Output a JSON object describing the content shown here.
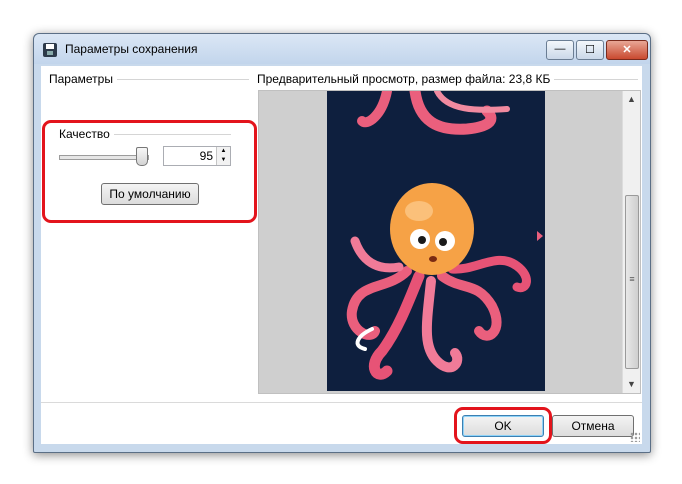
{
  "window": {
    "title": "Параметры сохранения",
    "minimize_glyph": "—",
    "maximize_glyph": "☐",
    "close_glyph": "✕"
  },
  "left_panel": {
    "group_label": "Параметры",
    "quality": {
      "label": "Качество",
      "value": "95",
      "slider_fraction": 0.95
    },
    "default_button_label": "По умолчанию"
  },
  "preview": {
    "header_label": "Предварительный просмотр, размер файла: 23,8 КБ",
    "scroll_up_glyph": "▲",
    "scroll_down_glyph": "▼",
    "scroll_grip_glyph": "≡"
  },
  "footer": {
    "ok_label": "OK",
    "cancel_label": "Отмена"
  },
  "colors": {
    "highlight_red": "#e3141c",
    "preview_background": "#0e1f3e",
    "octopus_orange": "#f6a246",
    "tentacle_pink": "#ea5f7d"
  }
}
